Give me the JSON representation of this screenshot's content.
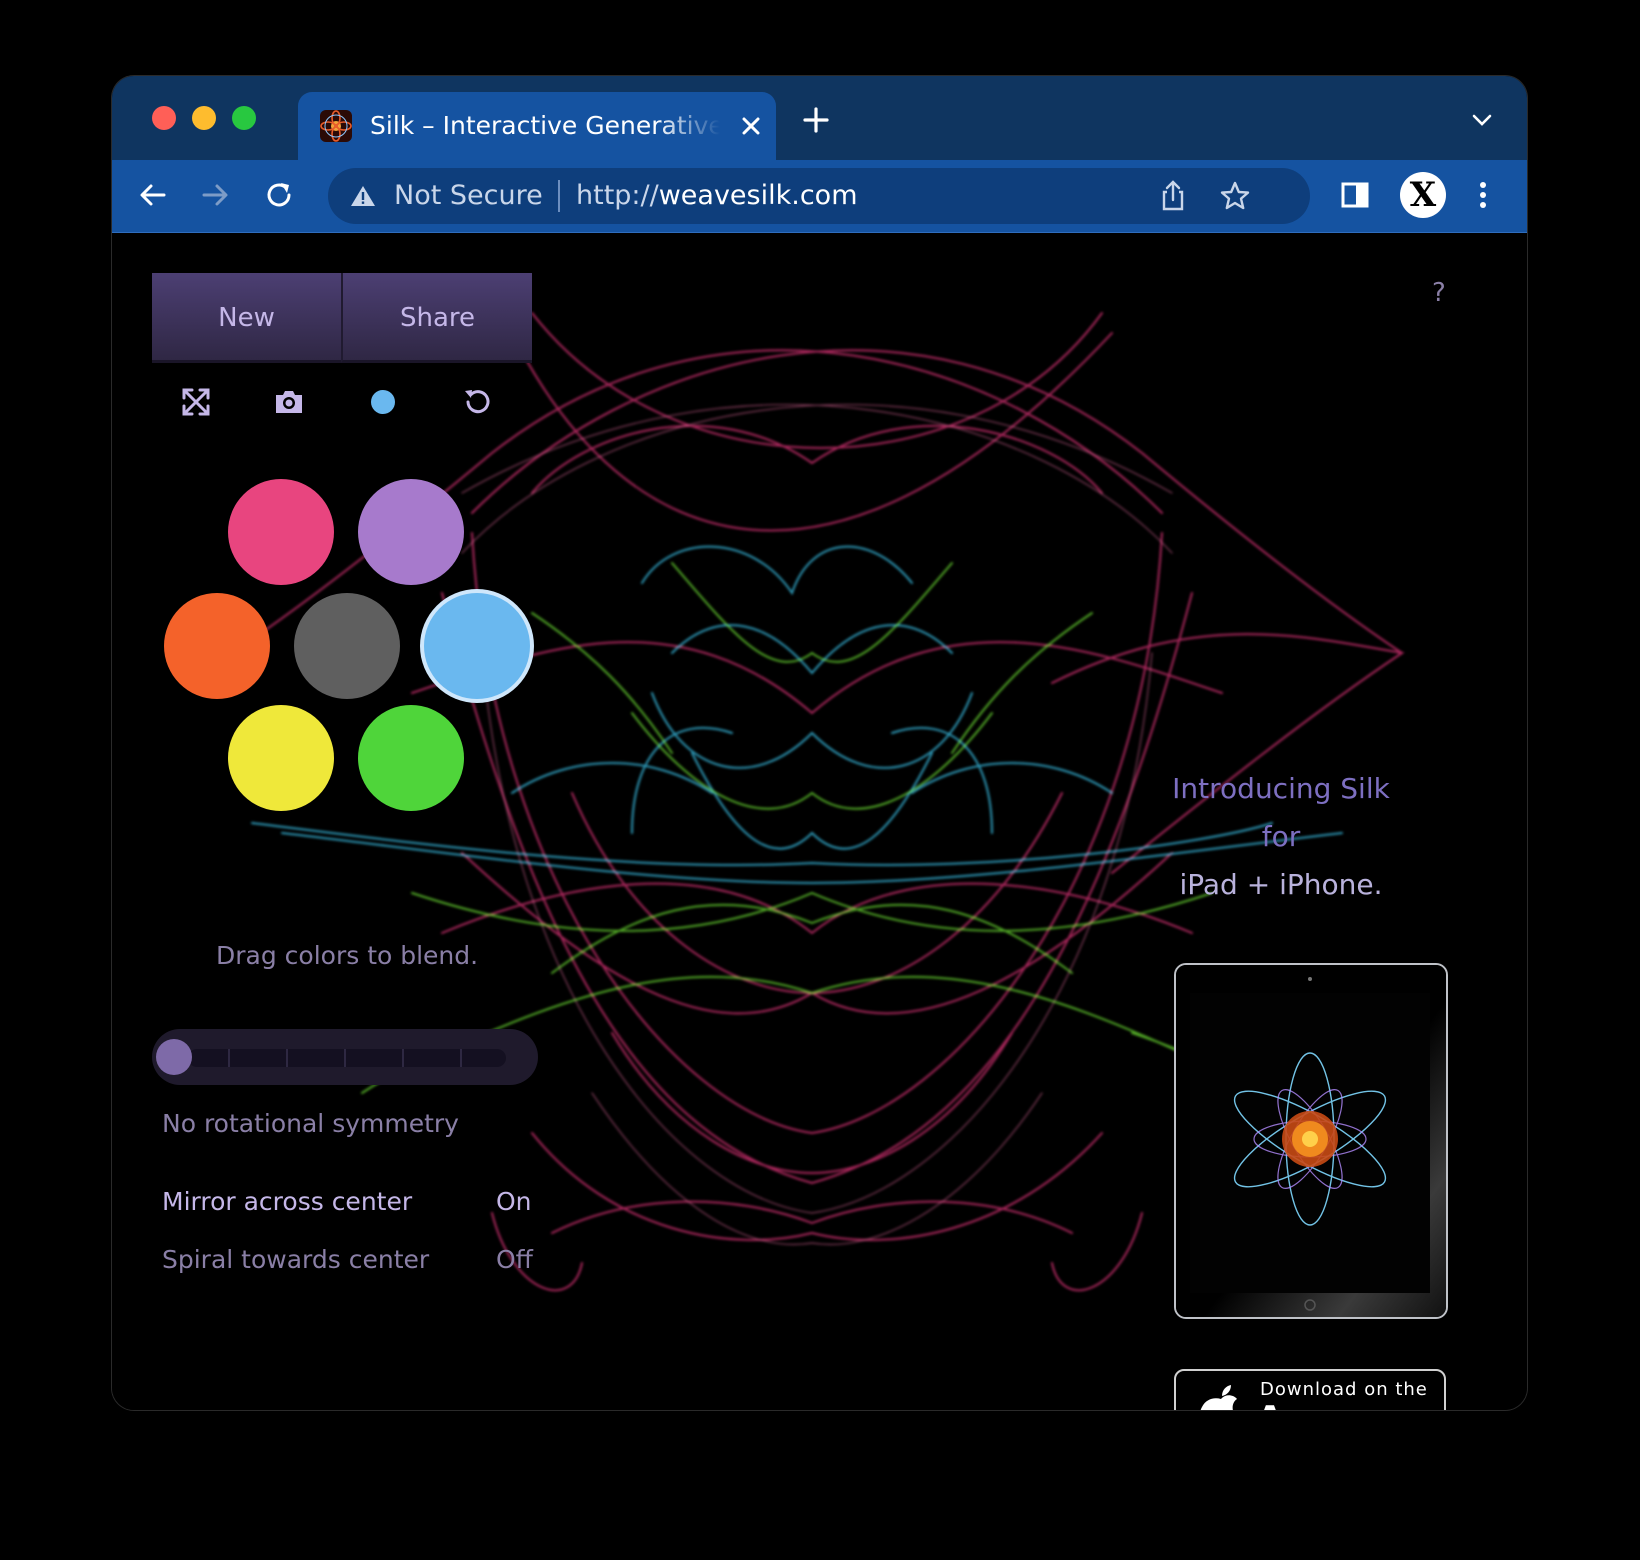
{
  "browser": {
    "tab_title": "Silk – Interactive Generative Art",
    "security_label": "Not Secure",
    "url_scheme": "http://",
    "url_host": "weavesilk.com",
    "profile_initial": "X",
    "accent": "#1553a1",
    "tabbar_color": "#0f3560",
    "traffic_lights": [
      "#ff5f57",
      "#febc2e",
      "#28c840"
    ]
  },
  "app": {
    "buttons": {
      "new": "New",
      "share": "Share"
    },
    "tools": [
      "fullscreen-icon",
      "camera-icon",
      "color-dot-icon",
      "undo-icon"
    ],
    "help": "?",
    "palette": [
      {
        "name": "pink",
        "color": "#e8457f"
      },
      {
        "name": "purple",
        "color": "#a77acc"
      },
      {
        "name": "orange",
        "color": "#f4622a"
      },
      {
        "name": "gray",
        "color": "#5f5f5f"
      },
      {
        "name": "blue",
        "color": "#6ab8ef",
        "selected": true
      },
      {
        "name": "yellow",
        "color": "#efe83a"
      },
      {
        "name": "green",
        "color": "#4fd53a"
      }
    ],
    "blend_hint": "Drag colors to blend.",
    "symmetry_level": 0,
    "symmetry_label": "No rotational symmetry",
    "settings": [
      {
        "label": "Mirror across center",
        "value": "On"
      },
      {
        "label": "Spiral towards center",
        "value": "Off"
      }
    ],
    "promo_line1": "Introducing Silk for",
    "promo_line2": "iPad + iPhone.",
    "appstore_small": "Download on the",
    "appstore_big": "App Store"
  }
}
